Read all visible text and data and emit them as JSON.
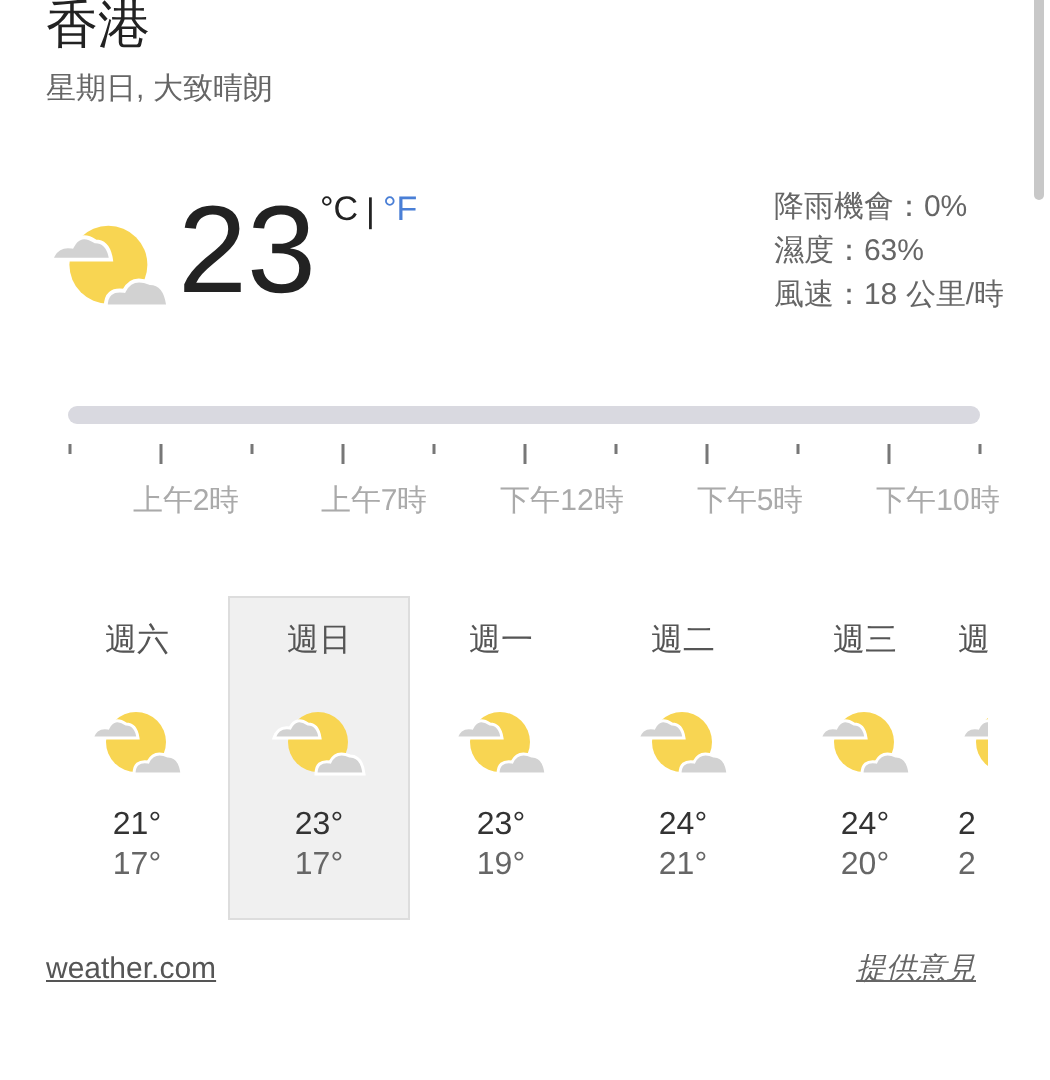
{
  "location": {
    "title": "香港",
    "subtitle": "星期日, 大致晴朗"
  },
  "current": {
    "temperature": "23",
    "units": [
      {
        "label": "°C",
        "selected": true
      },
      {
        "label": "°F",
        "selected": false
      }
    ],
    "separator": "|",
    "details": [
      "降雨機會：0%",
      "濕度：63%",
      "風速：18 公里/時"
    ]
  },
  "hourly": {
    "labels": [
      "上午2時",
      "上午7時",
      "下午12時",
      "下午5時",
      "下午10時"
    ]
  },
  "days": [
    {
      "day": "週六",
      "high": "21°",
      "low": "17°",
      "selected": false,
      "kind": "full"
    },
    {
      "day": "週日",
      "high": "23°",
      "low": "17°",
      "selected": true,
      "kind": "full"
    },
    {
      "day": "週一",
      "high": "23°",
      "low": "19°",
      "selected": false,
      "kind": "full"
    },
    {
      "day": "週二",
      "high": "24°",
      "low": "21°",
      "selected": false,
      "kind": "full"
    },
    {
      "day": "週三",
      "high": "24°",
      "low": "20°",
      "selected": false,
      "kind": "full"
    },
    {
      "day": "週",
      "high": "2",
      "low": "2",
      "selected": false,
      "kind": "partial"
    }
  ],
  "footer": {
    "source": "weather.com",
    "feedback": "提供意見"
  }
}
